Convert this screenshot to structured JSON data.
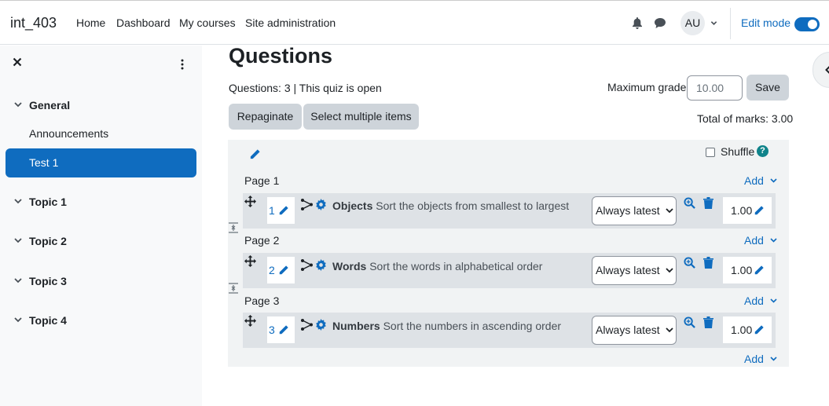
{
  "navbar": {
    "site_name": "int_403",
    "links": [
      "Home",
      "Dashboard",
      "My courses",
      "Site administration"
    ],
    "avatar_initials": "AU",
    "edit_mode_label": "Edit mode",
    "edit_mode_on": true
  },
  "drawer": {
    "sections": [
      {
        "title": "General",
        "items": [
          "Announcements",
          "Test 1"
        ]
      },
      {
        "title": "Topic 1"
      },
      {
        "title": "Topic 2"
      },
      {
        "title": "Topic 3"
      },
      {
        "title": "Topic 4"
      }
    ],
    "active_item": "Test 1"
  },
  "main": {
    "title": "Questions",
    "status": "Questions: 3 | This quiz is open",
    "max_grade_label": "Maximum grade",
    "max_grade_value": "10.00",
    "save_label": "Save",
    "repaginate_label": "Repaginate",
    "select_multiple_label": "Select multiple items",
    "total_marks": "Total of marks: 3.00",
    "shuffle_label": "Shuffle",
    "help_glyph": "?",
    "add_label": "Add",
    "pages": [
      {
        "label": "Page 1",
        "slot": "1",
        "name": "Objects",
        "text": "Sort the objects from smallest to largest",
        "version": "Always latest",
        "mark": "1.00"
      },
      {
        "label": "Page 2",
        "slot": "2",
        "name": "Words",
        "text": "Sort the words in alphabetical order",
        "version": "Always latest",
        "mark": "1.00"
      },
      {
        "label": "Page 3",
        "slot": "3",
        "name": "Numbers",
        "text": "Sort the numbers in ascending order",
        "version": "Always latest",
        "mark": "1.00"
      }
    ]
  },
  "colors": {
    "accent": "#0f6cbf",
    "drawer_bg": "#f8f9fa",
    "panel_bg": "#f1f3f4",
    "row_bg": "#dee2e6",
    "button_bg": "#ced4da",
    "help": "#0f838a"
  }
}
